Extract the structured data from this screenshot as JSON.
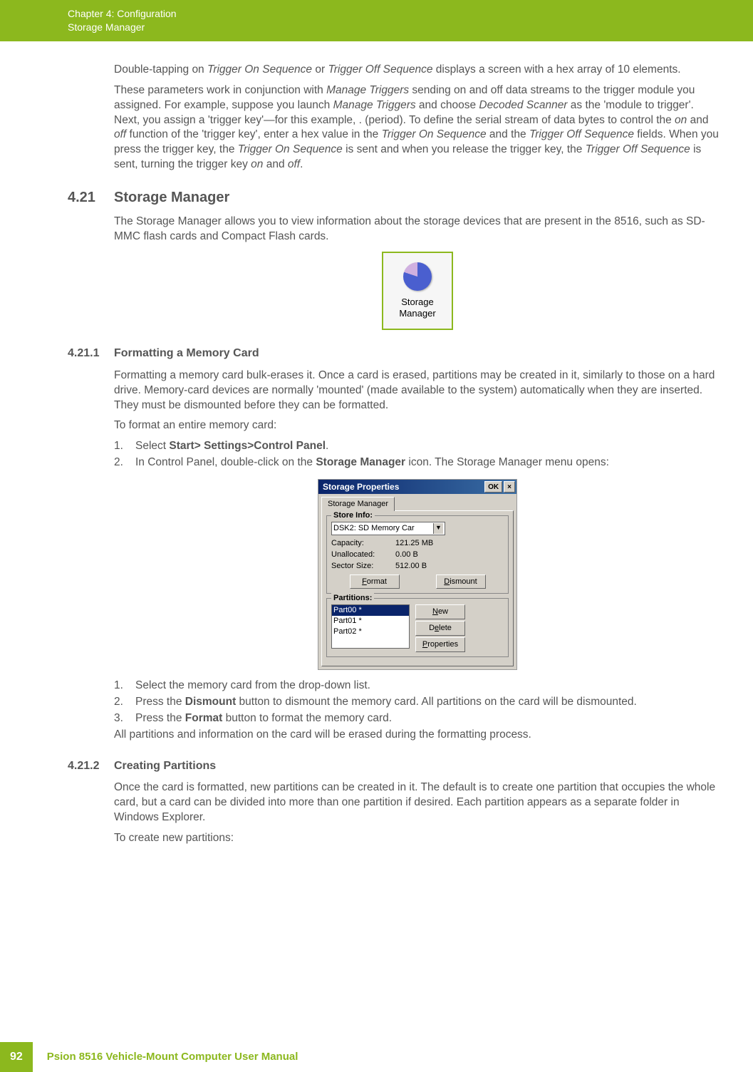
{
  "header": {
    "chapter": "Chapter 4:  Configuration",
    "section": "Storage Manager"
  },
  "intro": {
    "p1a": "Double-tapping on ",
    "p1i1": "Trigger On Sequence",
    "p1b": " or ",
    "p1i2": "Trigger Off Sequence",
    "p1c": " displays a screen with a hex array of 10 elements.",
    "p2a": "These parameters work in conjunction with ",
    "p2i1": "Manage Triggers",
    "p2b": " sending on and off data streams to the trigger module you assigned. For example, suppose you launch ",
    "p2i2": "Manage Triggers",
    "p2c": " and choose ",
    "p2i3": "Decoded Scanner",
    "p2d": " as the 'module to trigger'. Next, you assign a 'trigger key'—for this example, . (period). To define the serial stream of data bytes to control the ",
    "p2i4": "on",
    "p2e": " and ",
    "p2i5": "off",
    "p2f": " function of the 'trigger key', enter a hex value in the ",
    "p2i6": "Trigger On Sequence",
    "p2g": " and the ",
    "p2i7": "Trigger Off Sequence",
    "p2h": " fields. When you press the trigger key, the ",
    "p2i8": "Trigger On Sequence",
    "p2j": " is sent and when you release the trigger key, the ",
    "p2i9": "Trigger Off Sequence",
    "p2k": " is sent, turning the trigger key ",
    "p2i10": "on",
    "p2l": " and ",
    "p2i11": "off",
    "p2m": "."
  },
  "s421": {
    "num": "4.21",
    "title": "Storage Manager",
    "p1": "The Storage Manager allows you to view information about the storage devices that are present in the 8516, such as SD-MMC flash cards and Compact Flash cards.",
    "icon_line1": "Storage",
    "icon_line2": "Manager"
  },
  "s4211": {
    "num": "4.21.1",
    "title": "Formatting a Memory Card",
    "p1": "Formatting a memory card bulk-erases it. Once a card is erased, partitions may be created in it, similarly to those on a hard drive. Memory-card devices are normally 'mounted' (made available to the system) automatically when they are inserted. They must be dismounted before they can be formatted.",
    "p2": "To format an entire memory card:",
    "list1": {
      "n1": "1.",
      "t1a": "Select ",
      "t1b": "Start> Settings>Control Panel",
      "t1c": ".",
      "n2": "2.",
      "t2a": "In Control Panel, double-click on the ",
      "t2b": "Storage Manager",
      "t2c": " icon. The Storage Manager menu opens:"
    },
    "list2": {
      "n1": "1.",
      "t1": "Select the memory card from the drop-down list.",
      "n2": "2.",
      "t2a": "Press the ",
      "t2b": "Dismount",
      "t2c": " button to dismount the memory card. All partitions on the card will be dismounted.",
      "n3": "3.",
      "t3a": "Press the ",
      "t3b": "Format",
      "t3c": " button to format the memory card."
    },
    "p3": "All partitions and information on the card will be erased during the formatting process."
  },
  "dialog": {
    "title": "Storage Properties",
    "ok": "OK",
    "close": "×",
    "tab": "Storage Manager",
    "group1": "Store Info:",
    "combo": "DSK2: SD Memory Car",
    "cap_l": "Capacity:",
    "cap_v": "121.25 MB",
    "una_l": "Unallocated:",
    "una_v": "0.00 B",
    "sec_l": "Sector Size:",
    "sec_v": "512.00 B",
    "format": "Format",
    "format_u": "F",
    "dismount": "Dismount",
    "dismount_u": "D",
    "group2": "Partitions:",
    "p0": "Part00 *",
    "p1": "Part01 *",
    "p2": "Part02 *",
    "new": "New",
    "new_u": "N",
    "delete": "Delete",
    "delete_u": "e",
    "props": "Properties",
    "props_u": "P"
  },
  "s4212": {
    "num": "4.21.2",
    "title": "Creating Partitions",
    "p1": "Once the card is formatted, new partitions can be created in it. The default is to create one partition that occupies the whole card, but a card can be divided into more than one partition if desired. Each partition appears as a separate folder in Windows Explorer.",
    "p2": "To create new partitions:"
  },
  "footer": {
    "page": "92",
    "text": "Psion 8516 Vehicle-Mount Computer User Manual"
  }
}
